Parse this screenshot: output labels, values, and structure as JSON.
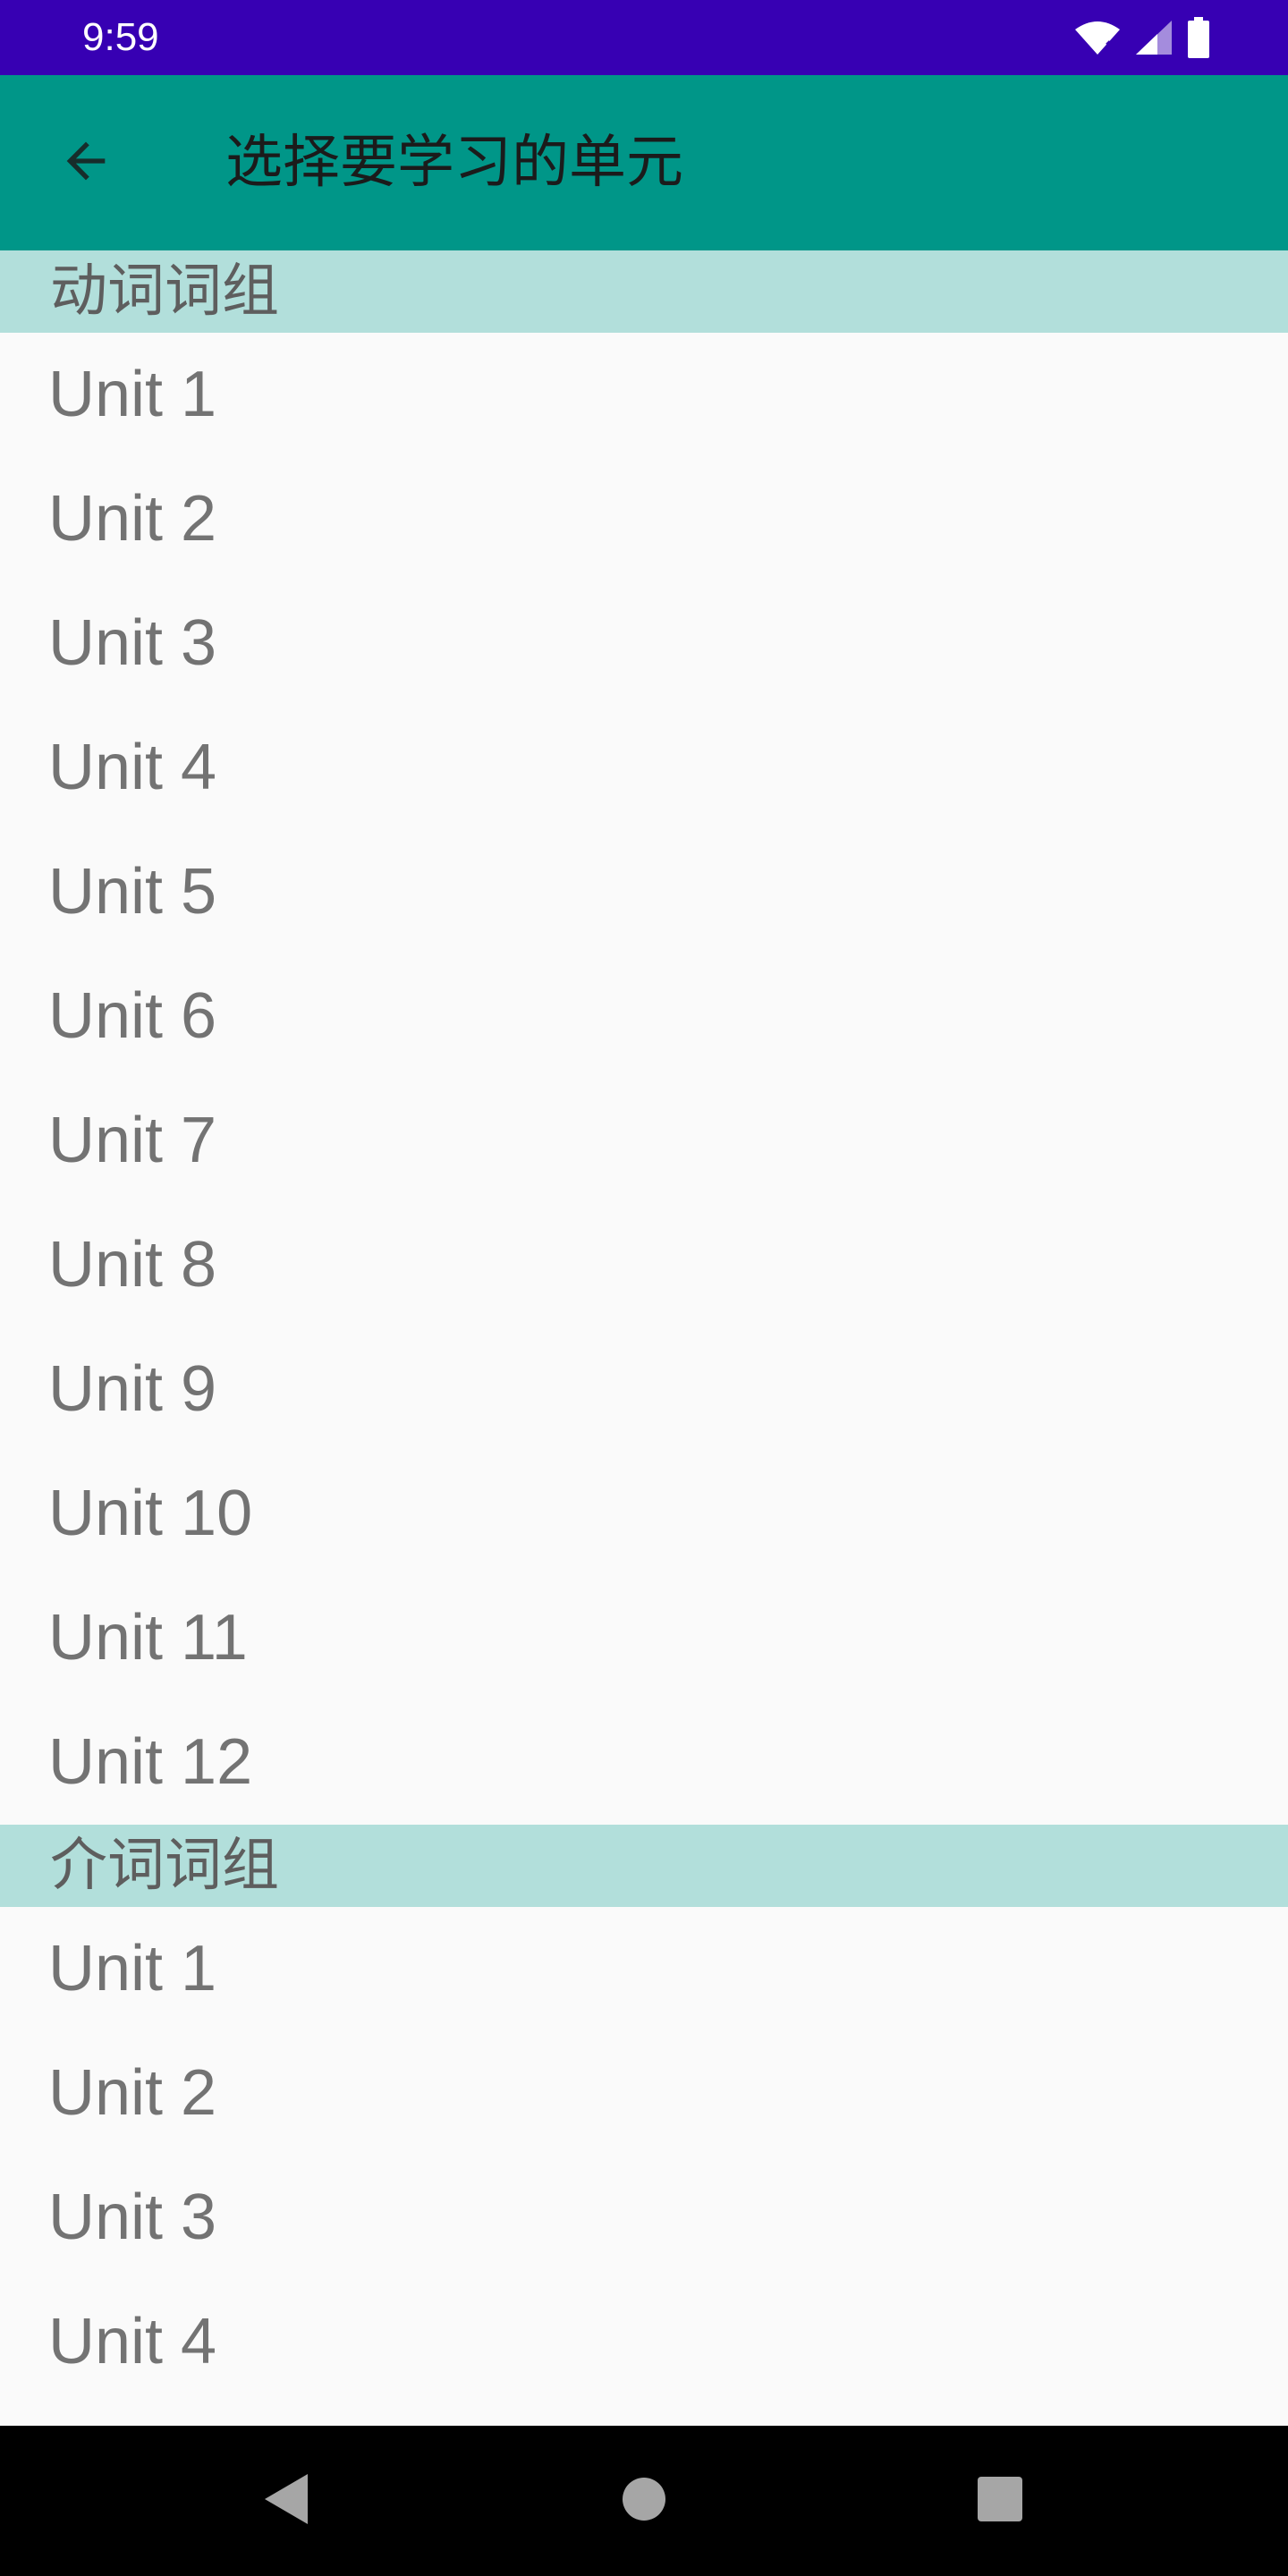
{
  "status_bar": {
    "time": "9:59",
    "icons": [
      "wifi-icon",
      "cellular-signal-icon",
      "battery-icon"
    ],
    "background_color": "#3700b3"
  },
  "app_bar": {
    "title": "选择要学习的单元",
    "back_icon": "arrow-back-icon",
    "background_color": "#009688"
  },
  "sections": [
    {
      "header": "动词词组",
      "items": [
        "Unit 1",
        "Unit 2",
        "Unit 3",
        "Unit 4",
        "Unit 5",
        "Unit 6",
        "Unit 7",
        "Unit 8",
        "Unit 9",
        "Unit 10",
        "Unit 11",
        "Unit 12"
      ]
    },
    {
      "header": "介词词组",
      "items": [
        "Unit 1",
        "Unit 2",
        "Unit 3",
        "Unit 4"
      ]
    }
  ],
  "colors": {
    "section_header_bg": "#b2dfdb",
    "list_bg": "#fafafa",
    "item_text": "#737373"
  },
  "nav_bar": {
    "buttons": [
      "nav-back-icon",
      "nav-home-icon",
      "nav-recents-icon"
    ]
  }
}
